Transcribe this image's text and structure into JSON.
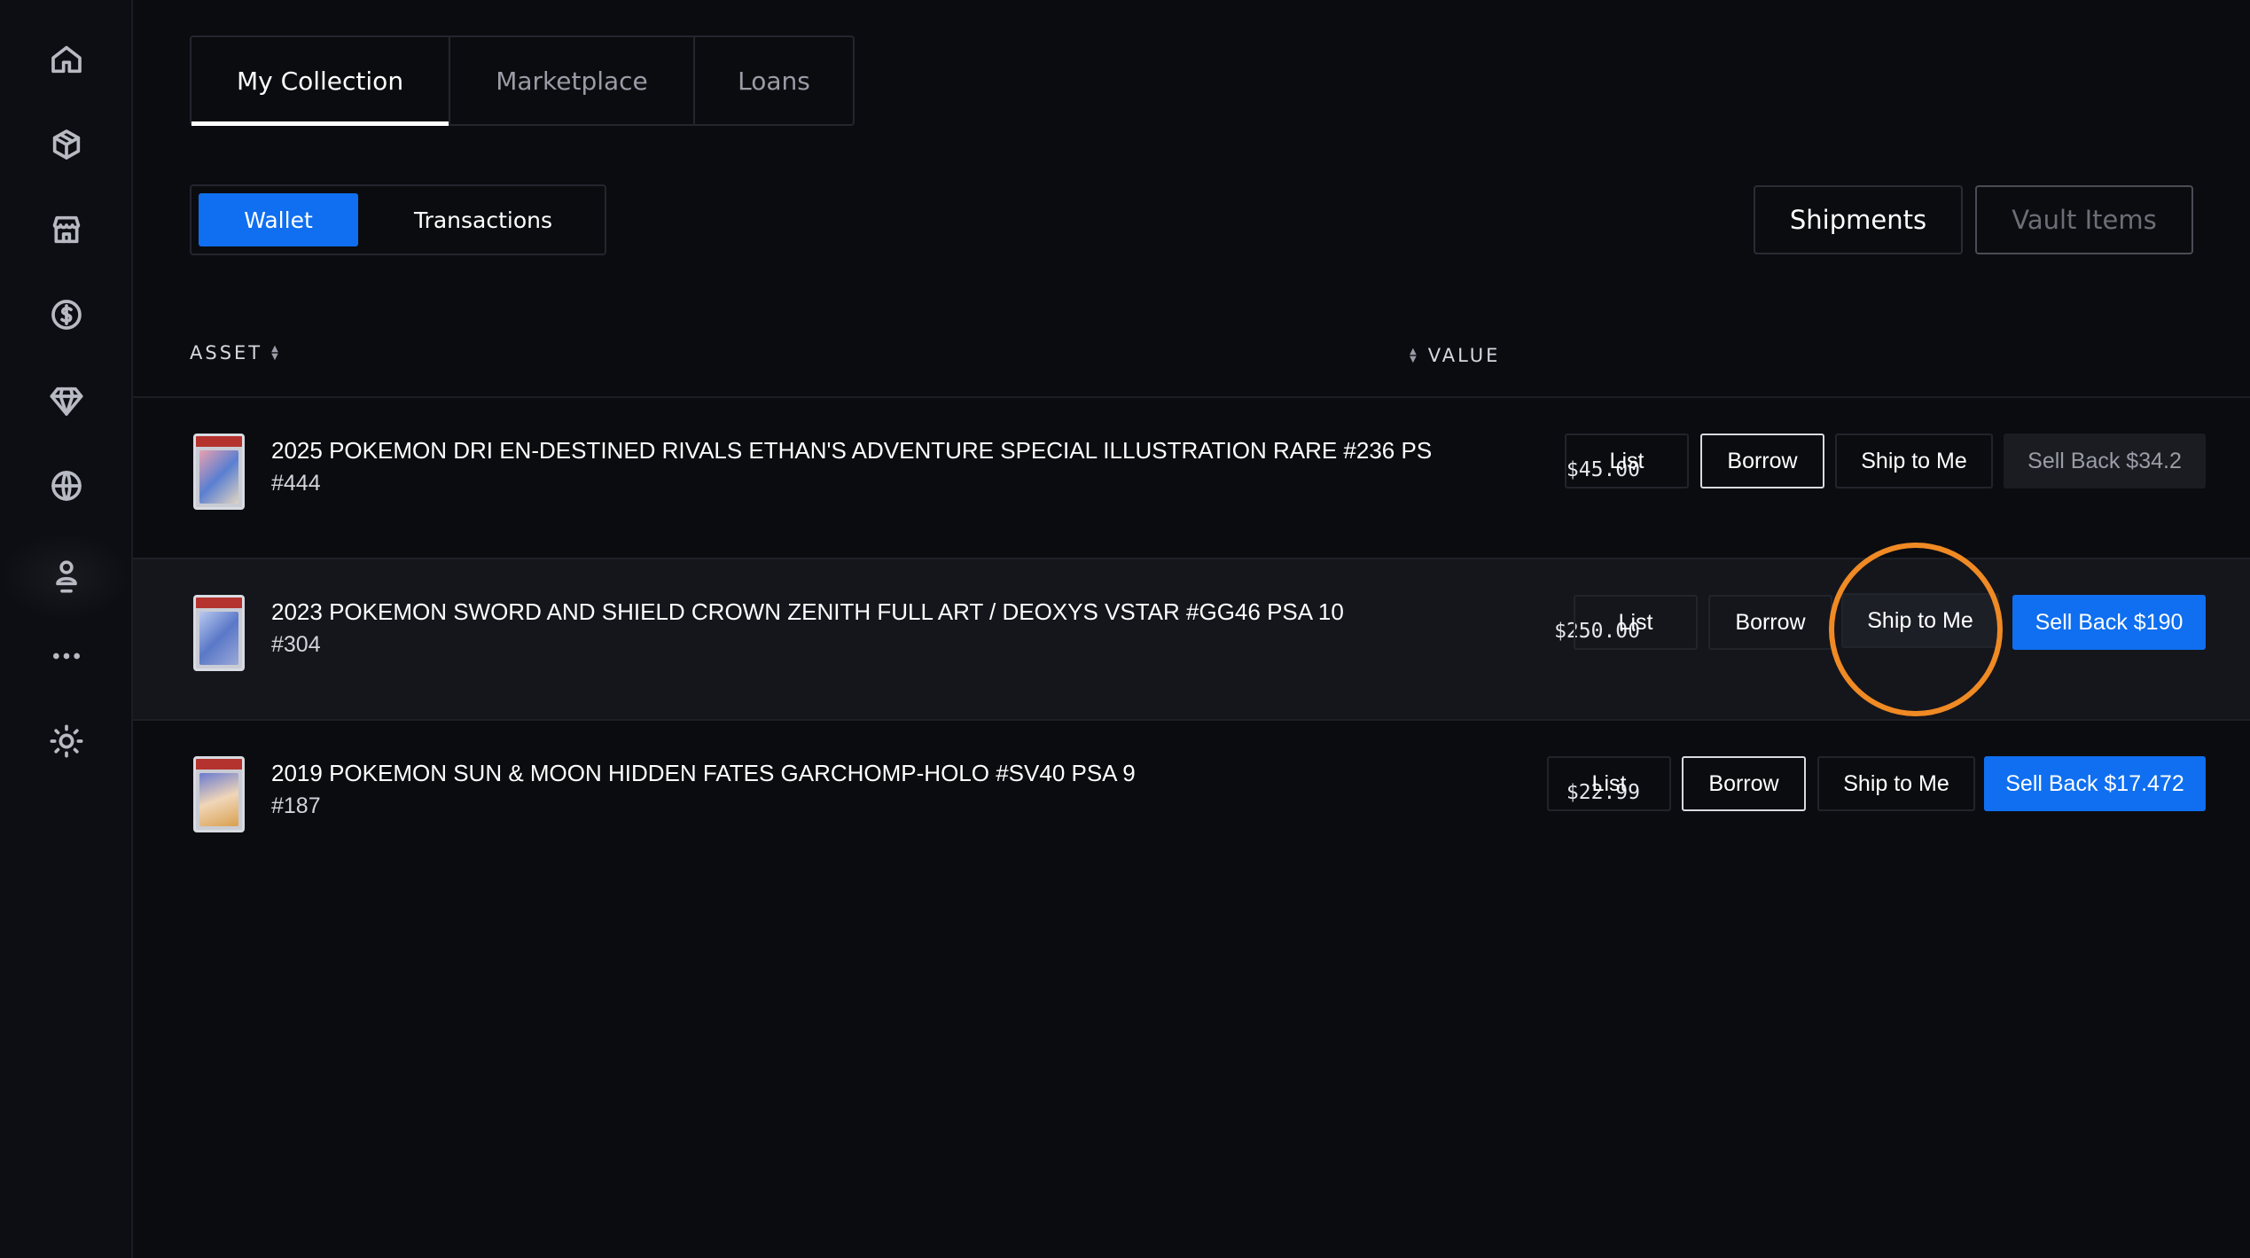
{
  "sidebar": {
    "items": [
      {
        "icon": "home-icon"
      },
      {
        "icon": "box-icon"
      },
      {
        "icon": "store-icon"
      },
      {
        "icon": "dollar-icon"
      },
      {
        "icon": "diamond-icon"
      },
      {
        "icon": "globe-icon"
      },
      {
        "icon": "user-icon"
      },
      {
        "icon": "more-icon"
      },
      {
        "icon": "sun-icon"
      }
    ]
  },
  "tabs": {
    "my_collection": "My Collection",
    "marketplace": "Marketplace",
    "loans": "Loans"
  },
  "subtabs": {
    "wallet": "Wallet",
    "transactions": "Transactions"
  },
  "header_buttons": {
    "shipments": "Shipments",
    "vault_items": "Vault Items"
  },
  "table": {
    "col_asset": "ASSET",
    "col_value": "VALUE",
    "rows": [
      {
        "name": "2025 POKEMON DRI EN-DESTINED RIVALS ETHAN'S ADVENTURE SPECIAL ILLUSTRATION RARE #236 PS",
        "number": "#444",
        "value": "$45.00",
        "list": "List",
        "borrow": "Borrow",
        "ship": "Ship to Me",
        "sell": "Sell Back $34.2"
      },
      {
        "name": "2023 POKEMON SWORD AND SHIELD CROWN ZENITH FULL ART / DEOXYS VSTAR #GG46 PSA 10",
        "number": "#304",
        "value": "$250.00",
        "list": "List",
        "borrow": "Borrow",
        "ship": "Ship to Me",
        "sell": "Sell Back $190"
      },
      {
        "name": "2019 POKEMON SUN & MOON HIDDEN FATES GARCHOMP-HOLO #SV40 PSA 9",
        "number": "#187",
        "value": "$22.99",
        "list": "List",
        "borrow": "Borrow",
        "ship": "Ship to Me",
        "sell": "Sell Back $17.472"
      }
    ]
  },
  "colors": {
    "accent": "#0f6ff0",
    "highlight_ring": "#f08a24",
    "background": "#0b0c10"
  }
}
